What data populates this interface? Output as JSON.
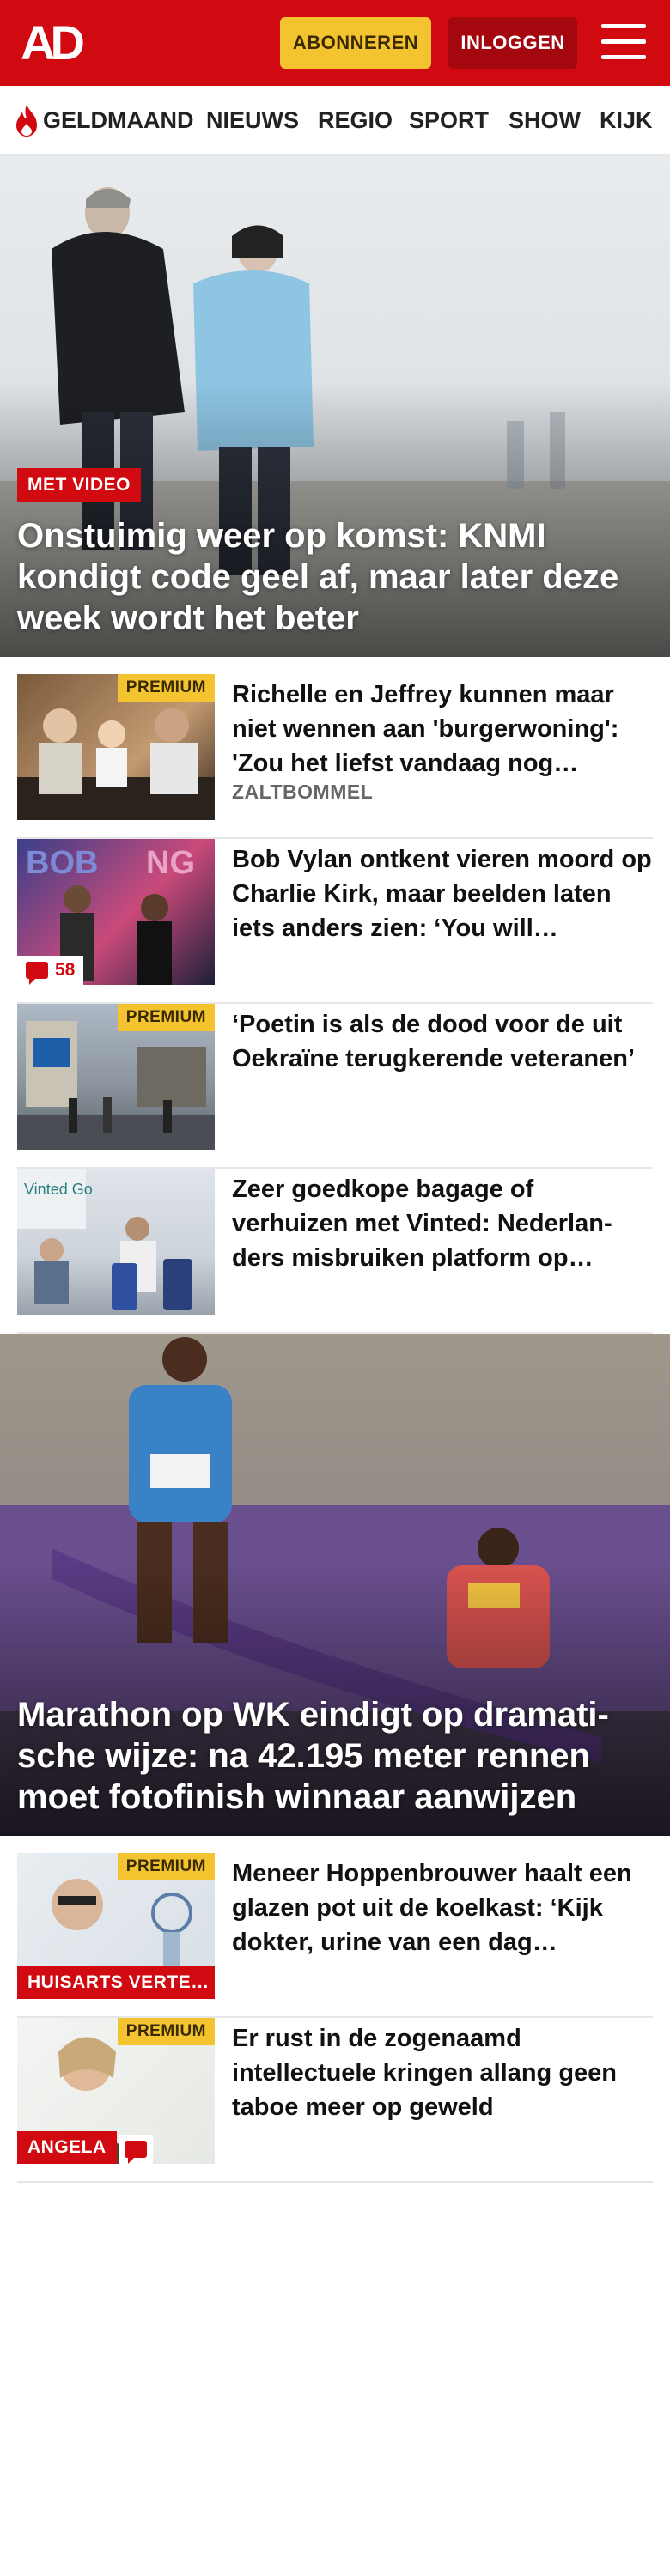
{
  "header": {
    "logo": "AD",
    "subscribe_label": "ABONNEREN",
    "login_label": "INLOGGEN"
  },
  "nav": {
    "items": [
      "GELDMAAND",
      "NIEUWS",
      "REGIO",
      "SPORT",
      "SHOW",
      "KIJK"
    ]
  },
  "hero1": {
    "badge": "MET VIDEO",
    "title": "Onstuimig weer op komst: KNMI kondigt code geel af, maar later deze week wordt het beter"
  },
  "articles1": [
    {
      "title": "Richelle en Jeffrey kunnen maar niet wennen aan 'burgerwoning': 'Zou het liefst vandaag nog…",
      "meta": "ZALTBOMMEL",
      "premium": "PREMIUM"
    },
    {
      "title": "Bob Vylan ontkent vieren moord op Charlie Kirk, maar beelden laten iets anders zien: ‘You will…",
      "comments": "58"
    },
    {
      "title": "‘Poetin is als de dood voor de uit Oekraïne terugkerende veteranen’",
      "premium": "PREMIUM"
    },
    {
      "title": "Zeer goedkope bagage of verhuizen met Vinted: Nederlan-ders misbruiken platform op…"
    }
  ],
  "hero2": {
    "title": "Marathon op WK eindigt op dramati-sche wijze: na 42.195 meter rennen moet fotofinish winnaar aanwijzen"
  },
  "articles2": [
    {
      "title": "Meneer Hoppenbrouwer haalt een glazen pot uit de koelkast: ‘Kijk dokter, urine van een dag…",
      "premium": "PREMIUM",
      "label": "HUISARTS VERTE…"
    },
    {
      "title": "Er rust in de zogenaamd intellectuele kringen allang geen taboe meer op geweld",
      "premium": "PREMIUM",
      "label": "ANGELA"
    }
  ],
  "colors": {
    "brand_red": "#d10a11",
    "premium_yellow": "#f4c430",
    "login_dark_red": "#a4070d"
  }
}
